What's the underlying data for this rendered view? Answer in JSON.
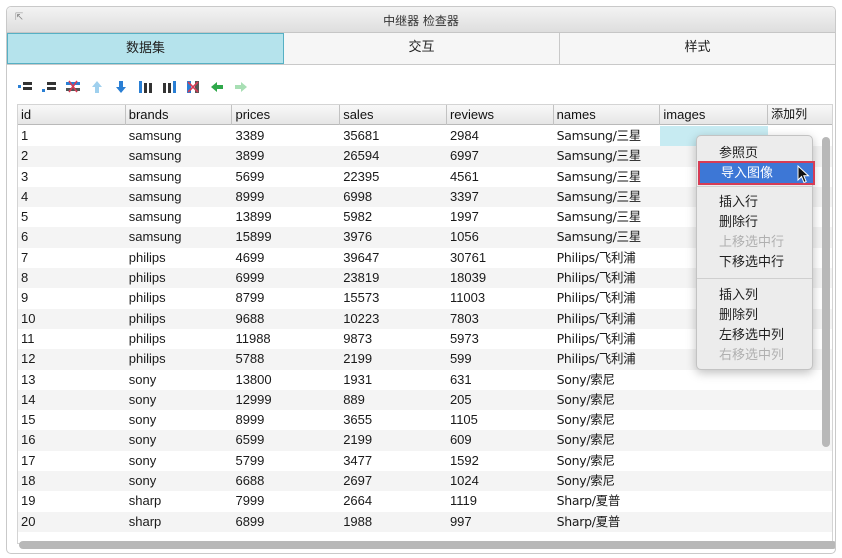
{
  "window": {
    "title": "中继器 检查器",
    "collapse_glyph": "⇱"
  },
  "tabs": [
    {
      "label": "数据集",
      "active": true
    },
    {
      "label": "交互",
      "active": false
    },
    {
      "label": "样式",
      "active": false
    }
  ],
  "toolbar": [
    "insert-row-above-icon",
    "insert-row-below-icon",
    "delete-row-icon",
    "move-row-up-icon",
    "move-row-down-icon",
    "insert-column-left-icon",
    "insert-column-right-icon",
    "delete-column-icon",
    "move-column-left-icon",
    "move-column-right-icon"
  ],
  "grid": {
    "columns": [
      "id",
      "brands",
      "prices",
      "sales",
      "reviews",
      "names",
      "images",
      "添加列"
    ],
    "rows": [
      [
        "1",
        "samsung",
        "3389",
        "35681",
        "2984",
        "Samsung/三星"
      ],
      [
        "2",
        "samsung",
        "3899",
        "26594",
        "6997",
        "Samsung/三星"
      ],
      [
        "3",
        "samsung",
        "5699",
        "22395",
        "4561",
        "Samsung/三星"
      ],
      [
        "4",
        "samsung",
        "8999",
        "6998",
        "3397",
        "Samsung/三星"
      ],
      [
        "5",
        "samsung",
        "13899",
        "5982",
        "1997",
        "Samsung/三星"
      ],
      [
        "6",
        "samsung",
        "15899",
        "3976",
        "1056",
        "Samsung/三星"
      ],
      [
        "7",
        "philips",
        "4699",
        "39647",
        "30761",
        "Philips/飞利浦"
      ],
      [
        "8",
        "philips",
        "6999",
        "23819",
        "18039",
        "Philips/飞利浦"
      ],
      [
        "9",
        "philips",
        "8799",
        "15573",
        "11003",
        "Philips/飞利浦"
      ],
      [
        "10",
        "philips",
        "9688",
        "10223",
        "7803",
        "Philips/飞利浦"
      ],
      [
        "11",
        "philips",
        "11988",
        "9873",
        "5973",
        "Philips/飞利浦"
      ],
      [
        "12",
        "philips",
        "5788",
        "2199",
        "599",
        "Philips/飞利浦"
      ],
      [
        "13",
        "sony",
        "13800",
        "1931",
        "631",
        "Sony/索尼"
      ],
      [
        "14",
        "sony",
        "12999",
        "889",
        "205",
        "Sony/索尼"
      ],
      [
        "15",
        "sony",
        "8999",
        "3655",
        "1105",
        "Sony/索尼"
      ],
      [
        "16",
        "sony",
        "6599",
        "2199",
        "609",
        "Sony/索尼"
      ],
      [
        "17",
        "sony",
        "5799",
        "3477",
        "1592",
        "Sony/索尼"
      ],
      [
        "18",
        "sony",
        "6688",
        "2697",
        "1024",
        "Sony/索尼"
      ],
      [
        "19",
        "sharp",
        "7999",
        "2664",
        "1119",
        "Sharp/夏普"
      ],
      [
        "20",
        "sharp",
        "6899",
        "1988",
        "997",
        "Sharp/夏普"
      ]
    ]
  },
  "context_menu": {
    "groups": [
      [
        {
          "label": "参照页",
          "enabled": true
        },
        {
          "label": "导入图像",
          "enabled": true,
          "highlighted": true
        }
      ],
      [
        {
          "label": "插入行",
          "enabled": true
        },
        {
          "label": "删除行",
          "enabled": true
        },
        {
          "label": "上移选中行",
          "enabled": false
        },
        {
          "label": "下移选中行",
          "enabled": true
        }
      ],
      [
        {
          "label": "插入列",
          "enabled": true
        },
        {
          "label": "删除列",
          "enabled": true
        },
        {
          "label": "左移选中列",
          "enabled": true
        },
        {
          "label": "右移选中列",
          "enabled": false
        }
      ]
    ]
  },
  "colors": {
    "tab_active": "#b5e3ec",
    "menu_highlight": "#3d77d6",
    "menu_highlight_border": "#d63c55",
    "selected_cell": "#c7ebf2"
  }
}
